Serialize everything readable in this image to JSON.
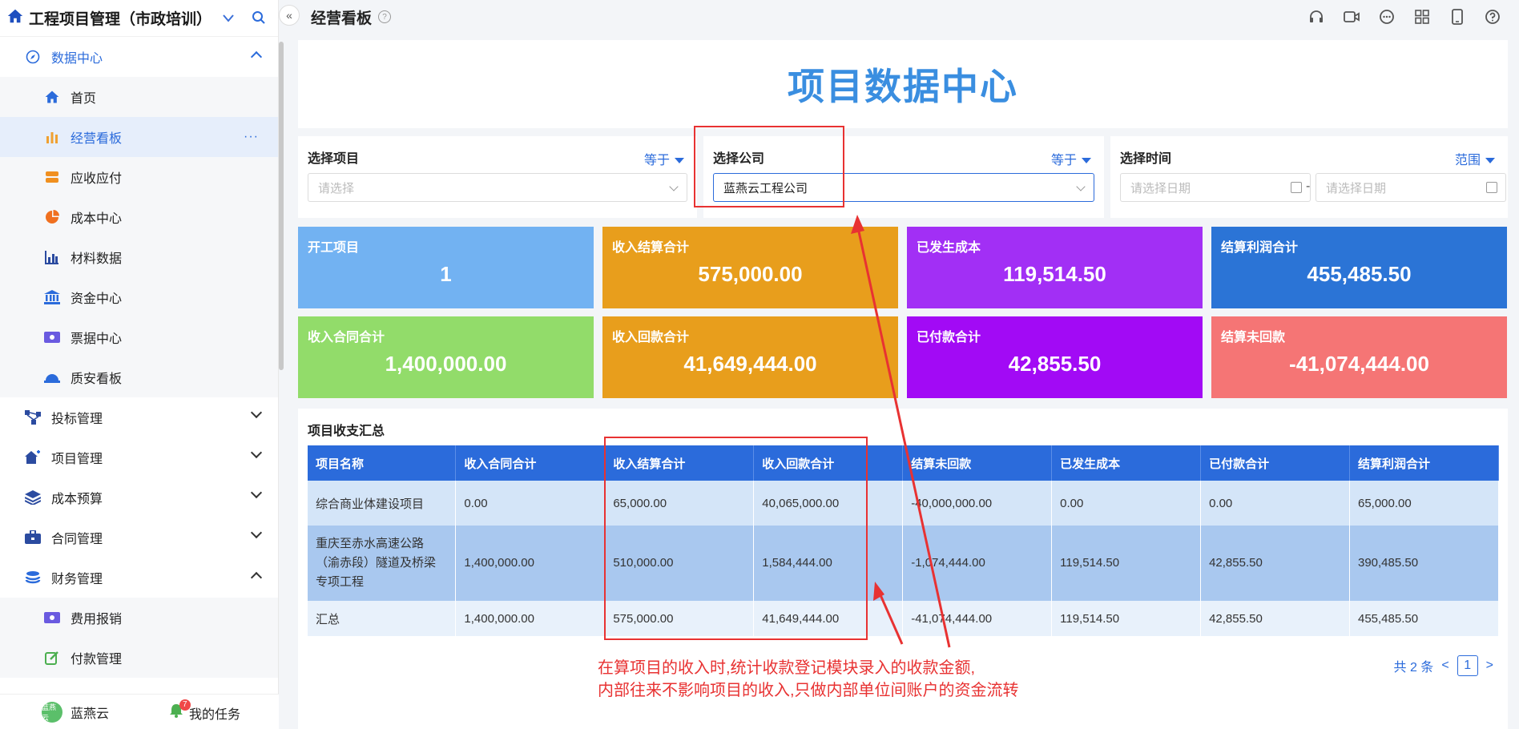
{
  "app": {
    "title": "工程项目管理（市政培训）"
  },
  "sidebar": {
    "groups": [
      {
        "label": "数据中心",
        "open": true,
        "items": [
          {
            "label": "首页"
          },
          {
            "label": "经营看板",
            "active": true,
            "more": "···"
          },
          {
            "label": "应收应付"
          },
          {
            "label": "成本中心"
          },
          {
            "label": "材料数据"
          },
          {
            "label": "资金中心"
          },
          {
            "label": "票据中心"
          },
          {
            "label": "质安看板"
          }
        ]
      },
      {
        "label": "投标管理"
      },
      {
        "label": "项目管理"
      },
      {
        "label": "成本预算"
      },
      {
        "label": "合同管理"
      },
      {
        "label": "财务管理",
        "open": true,
        "items": [
          {
            "label": "费用报销"
          },
          {
            "label": "付款管理"
          }
        ]
      }
    ],
    "user": {
      "avatar_text": "蓝燕云",
      "name": "蓝燕云"
    },
    "tasks": {
      "label": "我的任务",
      "badge": "7"
    }
  },
  "header": {
    "page_title": "经营看板",
    "icons": [
      "headset-icon",
      "video-icon",
      "chat-icon",
      "apps-icon",
      "mobile-icon",
      "help-icon"
    ]
  },
  "banner": {
    "title": "项目数据中心"
  },
  "filters": {
    "project": {
      "label": "选择项目",
      "op": "等于",
      "placeholder": "请选择"
    },
    "company": {
      "label": "选择公司",
      "op": "等于",
      "value": "蓝燕云工程公司"
    },
    "time": {
      "label": "选择时间",
      "op": "范围",
      "start_placeholder": "请选择日期",
      "end_placeholder": "请选择日期",
      "sep": "-"
    }
  },
  "cards": [
    {
      "label": "开工项目",
      "value": "1",
      "color": "#72b2f2"
    },
    {
      "label": "收入结算合计",
      "value": "575,000.00",
      "color": "#e89e1c"
    },
    {
      "label": "已发生成本",
      "value": "119,514.50",
      "color": "#a22ff5"
    },
    {
      "label": "结算利润合计",
      "value": "455,485.50",
      "color": "#2b74d6"
    },
    {
      "label": "收入合同合计",
      "value": "1,400,000.00",
      "color": "#92dc6a"
    },
    {
      "label": "收入回款合计",
      "value": "41,649,444.00",
      "color": "#e89e1c"
    },
    {
      "label": "已付款合计",
      "value": "42,855.50",
      "color": "#a20af5"
    },
    {
      "label": "结算未回款",
      "value": "-41,074,444.00",
      "color": "#f57575"
    }
  ],
  "table": {
    "title": "项目收支汇总",
    "headers": [
      "项目名称",
      "收入合同合计",
      "收入结算合计",
      "收入回款合计",
      "结算未回款",
      "已发生成本",
      "已付款合计",
      "结算利润合计"
    ],
    "rows": [
      [
        "综合商业体建设项目",
        "0.00",
        "65,000.00",
        "40,065,000.00",
        "-40,000,000.00",
        "0.00",
        "0.00",
        "65,000.00"
      ],
      [
        "重庆至赤水高速公路（渝赤段）隧道及桥梁专项工程",
        "1,400,000.00",
        "510,000.00",
        "1,584,444.00",
        "-1,074,444.00",
        "119,514.50",
        "42,855.50",
        "390,485.50"
      ],
      [
        "汇总",
        "1,400,000.00",
        "575,000.00",
        "41,649,444.00",
        "-41,074,444.00",
        "119,514.50",
        "42,855.50",
        "455,485.50"
      ]
    ]
  },
  "pager": {
    "total": "共 2 条",
    "page": "1",
    "prev": "<",
    "next": ">"
  },
  "annotation": {
    "line1": "在算项目的收入时,统计收款登记模块录入的收款金额,",
    "line2": "内部往来不影响项目的收入,只做内部单位间账户的资金流转"
  }
}
